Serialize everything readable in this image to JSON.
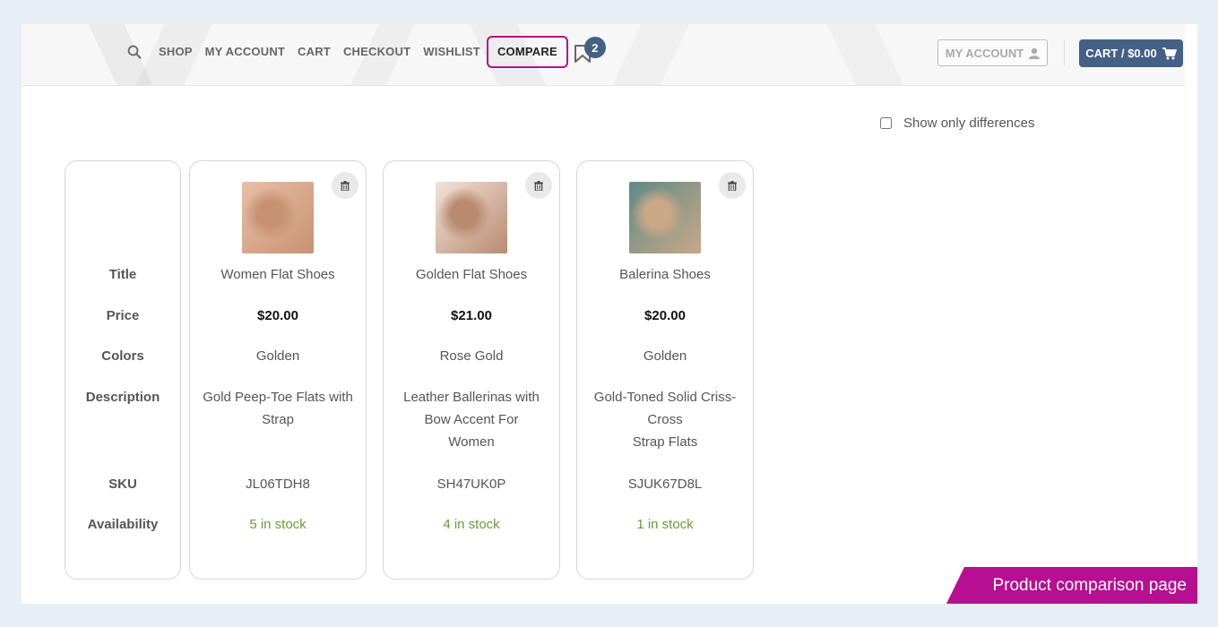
{
  "nav": {
    "items": [
      "SHOP",
      "MY ACCOUNT",
      "CART",
      "CHECKOUT",
      "WISHLIST",
      "COMPARE"
    ],
    "active": "COMPARE",
    "compare_count": "2"
  },
  "header": {
    "account_label": "MY ACCOUNT",
    "cart_label": "CART / $0.00"
  },
  "filter": {
    "show_differences_label": "Show only differences",
    "checked": false
  },
  "table": {
    "row_labels": [
      "Title",
      "Price",
      "Colors",
      "Description",
      "SKU",
      "Availability"
    ],
    "products": [
      {
        "title": "Women Flat Shoes",
        "price": "$20.00",
        "color": "Golden",
        "description": [
          "Gold Peep-Toe Flats with",
          "Strap"
        ],
        "sku": "JL06TDH8",
        "availability": "5 in stock",
        "thumb_colors": [
          "#e9bfa6",
          "#c89272"
        ]
      },
      {
        "title": "Golden Flat Shoes",
        "price": "$21.00",
        "color": "Rose Gold",
        "description": [
          "Leather Ballerinas with",
          "Bow Accent For",
          "Women"
        ],
        "sku": "SH47UK0P",
        "availability": "4 in stock",
        "thumb_colors": [
          "#f2e3d8",
          "#b98a70"
        ]
      },
      {
        "title": "Balerina Shoes",
        "price": "$20.00",
        "color": "Golden",
        "description": [
          "Gold-Toned Solid Criss-",
          "Cross",
          "Strap Flats"
        ],
        "sku": "SJUK67D8L",
        "availability": "1 in stock",
        "thumb_colors": [
          "#5e8a86",
          "#c9a888"
        ]
      }
    ]
  },
  "banner": {
    "text": "Product comparison page"
  },
  "colors": {
    "accent": "#b0128e",
    "brand": "#446084",
    "stock": "#6a9a3a"
  },
  "icons": {
    "search": "search-icon",
    "bookmark": "bookmark-icon",
    "user": "user-icon",
    "cart": "cart-icon",
    "trash": "trash-icon"
  }
}
